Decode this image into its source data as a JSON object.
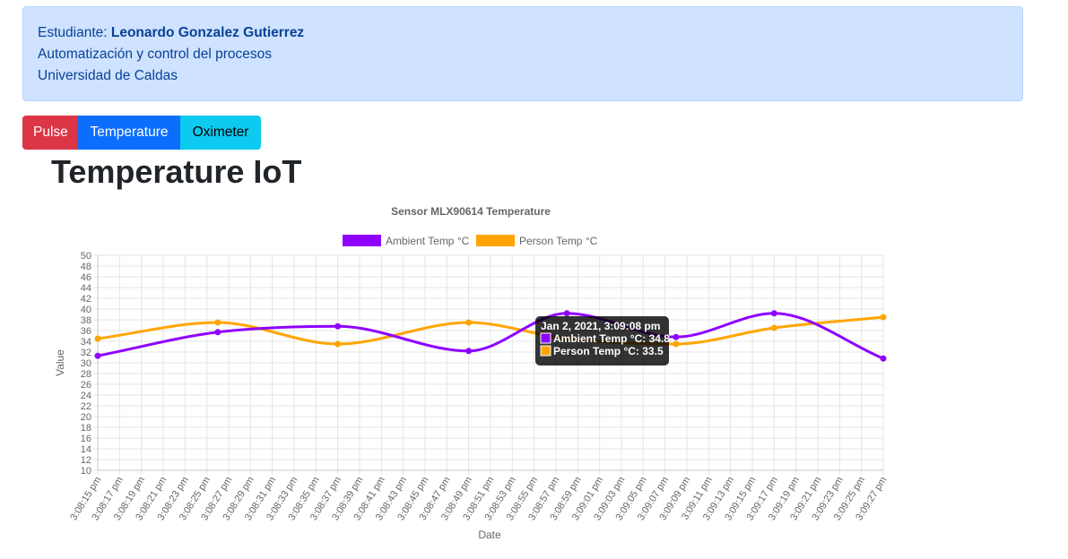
{
  "info": {
    "student_label": "Estudiante:",
    "student_name": "Leonardo Gonzalez Gutierrez",
    "course": "Automatización y control del procesos",
    "university": "Universidad de Caldas"
  },
  "buttons": {
    "pulse": "Pulse",
    "temperature": "Temperature",
    "oximeter": "Oximeter"
  },
  "page_title": "Temperature IoT",
  "colors": {
    "info_bg": "#cfe2ff",
    "pulse": "#dc3545",
    "temperature": "#0d6efd",
    "oximeter": "#0dcaf0",
    "ambient": "#8f00ff",
    "person": "#ffa500"
  },
  "chart_data": {
    "type": "line",
    "title": "Sensor MLX90614 Temperature",
    "xlabel": "Date",
    "ylabel": "Value",
    "ylim": [
      10,
      50
    ],
    "y_ticks": [
      10,
      12,
      14,
      16,
      18,
      20,
      22,
      24,
      26,
      28,
      30,
      32,
      34,
      36,
      38,
      40,
      42,
      44,
      46,
      48,
      50
    ],
    "x_ticks": [
      "3:08:15 pm",
      "3:08:17 pm",
      "3:08:19 pm",
      "3:08:21 pm",
      "3:08:23 pm",
      "3:08:25 pm",
      "3:08:27 pm",
      "3:08:29 pm",
      "3:08:31 pm",
      "3:08:33 pm",
      "3:08:35 pm",
      "3:08:37 pm",
      "3:08:39 pm",
      "3:08:41 pm",
      "3:08:43 pm",
      "3:08:45 pm",
      "3:08:47 pm",
      "3:08:49 pm",
      "3:08:51 pm",
      "3:08:53 pm",
      "3:08:55 pm",
      "3:08:57 pm",
      "3:08:59 pm",
      "3:09:01 pm",
      "3:09:03 pm",
      "3:09:05 pm",
      "3:09:07 pm",
      "3:09:09 pm",
      "3:09:11 pm",
      "3:09:13 pm",
      "3:09:15 pm",
      "3:09:17 pm",
      "3:09:19 pm",
      "3:09:21 pm",
      "3:09:23 pm",
      "3:09:25 pm",
      "3:09:27 pm"
    ],
    "x": [
      "3:08:15 pm",
      "3:08:26 pm",
      "3:08:37 pm",
      "3:08:49 pm",
      "3:08:58 pm",
      "3:09:08 pm",
      "3:09:17 pm",
      "3:09:27 pm"
    ],
    "series": [
      {
        "name": "Ambient Temp °C",
        "color": "#8f00ff",
        "values": [
          31.3,
          35.7,
          36.8,
          32.2,
          39.2,
          34.8,
          39.2,
          30.8
        ]
      },
      {
        "name": "Person Temp °C",
        "color": "#ffa500",
        "values": [
          34.5,
          37.5,
          33.5,
          37.5,
          34.5,
          33.5,
          36.5,
          38.5
        ]
      }
    ],
    "grid": true,
    "legend": "top",
    "tooltip": {
      "title": "Jan 2, 2021, 3:09:08 pm",
      "lines": [
        "Ambient Temp °C: 34.8",
        "Person Temp °C: 33.5"
      ]
    }
  }
}
